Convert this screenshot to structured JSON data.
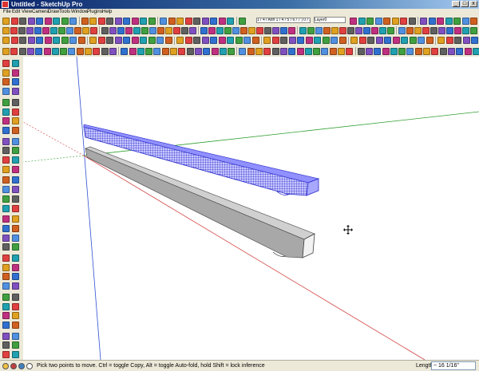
{
  "window": {
    "title": "Untitled - SketchUp Pro"
  },
  "window_buttons": {
    "minimize": "_",
    "maximize": "□",
    "close": "x"
  },
  "menu": [
    "File",
    "Edit",
    "View",
    "Camera",
    "Draw",
    "Tools",
    "Window",
    "Plugins",
    "Help"
  ],
  "toolbar": {
    "color_scale_text": "1 / 4 / Ash 1 / 4 / 5 / 6 / 7 | 0 / 3 | 0 / 5 / 00",
    "layer_value": "Layer0"
  },
  "statusbar": {
    "hint": "Pick two points to move.  Ctrl = toggle Copy, Alt = toggle Auto-fold, hold Shift = lock inference",
    "measurement_label": "Length",
    "measurement_value": "~ 16 1/16\""
  },
  "accent_colors": {
    "title_bar": "#0a246a",
    "selection_blue": "#2828c8",
    "axis_red": "#d04040",
    "axis_green": "#30a030",
    "axis_blue": "#3050d0"
  },
  "icons": [
    "select",
    "paint-bucket",
    "eraser",
    "rectangle",
    "line",
    "circle",
    "arc",
    "polygon",
    "freehand",
    "move",
    "push-pull",
    "rotate",
    "follow-me",
    "scale",
    "offset",
    "tape-measure",
    "dimension",
    "protractor",
    "text",
    "axes",
    "3d-text",
    "orbit",
    "pan",
    "zoom",
    "zoom-window",
    "zoom-extents",
    "previous-view",
    "next-view",
    "position-camera",
    "walk",
    "look-around",
    "section-plane"
  ],
  "viewport": {
    "cursor": "move-cursor"
  }
}
